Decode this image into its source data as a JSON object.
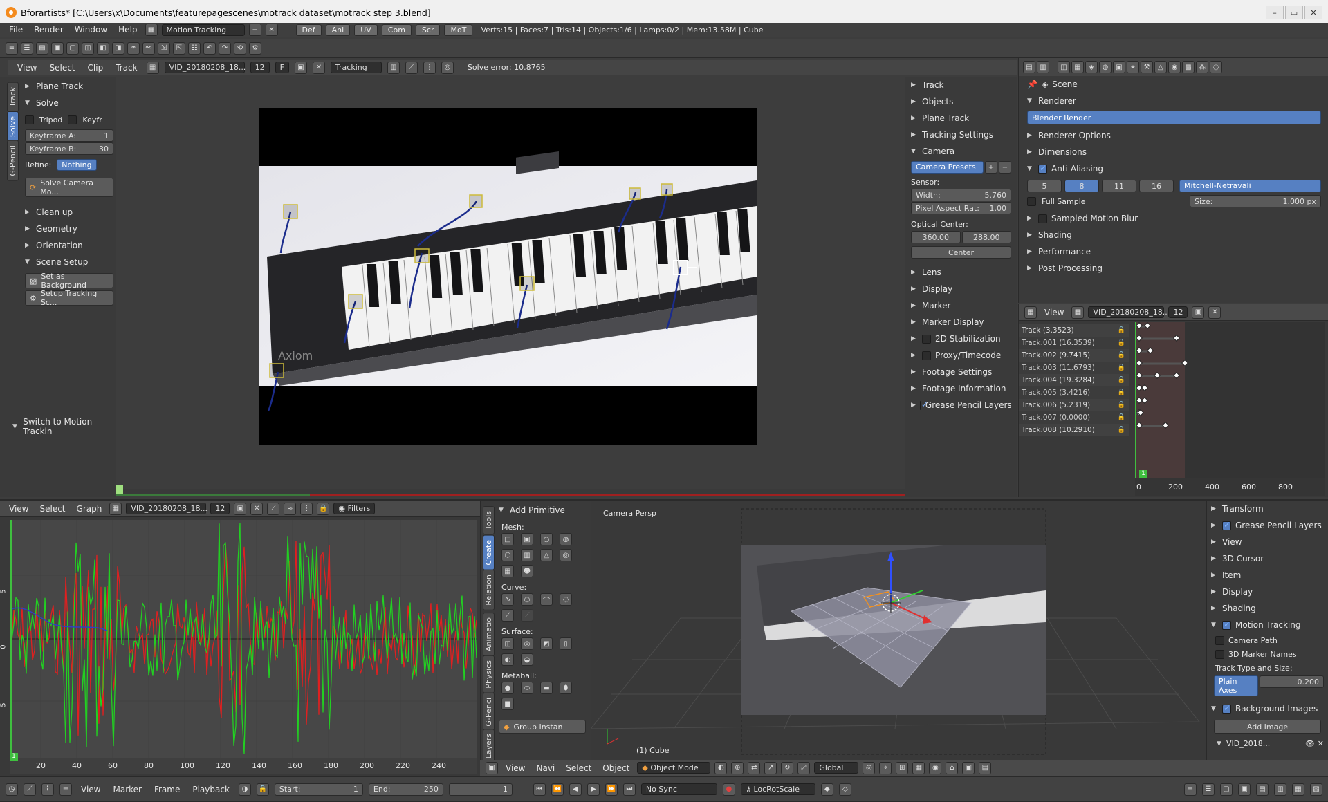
{
  "window": {
    "title": "Bforartists* [C:\\Users\\x\\Documents\\featurepagescenes\\motrack dataset\\motrack step 3.blend]"
  },
  "topbar": {
    "menus": [
      "File",
      "Render",
      "Window",
      "Help"
    ],
    "workspace": "Motion Tracking",
    "tabs": [
      "Def",
      "Ani",
      "UV",
      "Com",
      "Scr",
      "MoT"
    ],
    "stats": "Verts:15 | Faces:7 | Tris:14 | Objects:1/6 | Lamps:0/2 | Mem:13.58M | Cube"
  },
  "clip_header": {
    "menus": [
      "View",
      "Select",
      "Clip",
      "Track"
    ],
    "clip_name": "VID_20180208_18...",
    "clip_users": "12",
    "fake": "F",
    "mode": "Tracking",
    "solve_error": "Solve error: 10.8765"
  },
  "toolshelf": {
    "tabs": [
      "Track",
      "Solve",
      "G-Pencil"
    ],
    "plane_track": "Plane Track",
    "solve": "Solve",
    "tripod": "Tripod",
    "keyframe": "Keyfr",
    "keyframe_a_label": "Keyframe A:",
    "keyframe_a_val": "1",
    "keyframe_b_label": "Keyframe B:",
    "keyframe_b_val": "30",
    "refine_label": "Refine:",
    "refine_val": "Nothing",
    "solve_btn": "Solve Camera Mo...",
    "cleanup": "Clean up",
    "geometry": "Geometry",
    "orientation": "Orientation",
    "scene_setup": "Scene Setup",
    "set_bg": "Set as Background",
    "setup_scene": "Setup Tracking Sc...",
    "switch": "Switch to Motion Trackin"
  },
  "clip_props": {
    "items_top": [
      "Track",
      "Objects",
      "Plane Track",
      "Tracking Settings"
    ],
    "camera": "Camera",
    "camera_presets": "Camera Presets",
    "sensor": "Sensor:",
    "width_label": "Width:",
    "width_val": "5.760",
    "par_label": "Pixel Aspect Rat:",
    "par_val": "1.00",
    "optical": "Optical Center:",
    "oc_x": "360.00",
    "oc_y": "288.00",
    "center": "Center",
    "items_bottom": [
      "Lens",
      "Display",
      "Marker",
      "Marker Display"
    ],
    "stab": "2D Stabilization",
    "proxy": "Proxy/Timecode",
    "footage_settings": "Footage Settings",
    "footage_info": "Footage Information",
    "gp_layers": "Grease Pencil Layers"
  },
  "render_props": {
    "scene": "Scene",
    "renderer": "Renderer",
    "engine": "Blender Render",
    "items": [
      "Renderer Options",
      "Dimensions"
    ],
    "aa": "Anti-Aliasing",
    "aa_samples": [
      "5",
      "8",
      "11",
      "16"
    ],
    "filter": "Mitchell-Netravali",
    "full_sample": "Full Sample",
    "size_label": "Size:",
    "size_val": "1.000 px",
    "smb": "Sampled Motion Blur",
    "more": [
      "Shading",
      "Performance",
      "Post Processing"
    ]
  },
  "dopesheet": {
    "view": "View",
    "clip_name": "VID_20180208_18...",
    "clip_users": "12",
    "tracks": [
      "Track (3.3523)",
      "Track.001 (16.3539)",
      "Track.002 (9.7415)",
      "Track.003 (11.6793)",
      "Track.004 (19.3284)",
      "Track.005 (3.4216)",
      "Track.006 (5.2319)",
      "Track.007 (0.0000)",
      "Track.008 (10.2910)"
    ],
    "axis": [
      "0",
      "200",
      "400",
      "600",
      "800"
    ],
    "current_frame": "1"
  },
  "graph": {
    "menus": [
      "View",
      "Select",
      "Graph"
    ],
    "clip_name": "VID_20180208_18...",
    "clip_users": "12",
    "filters": "Filters",
    "x_ticks": [
      "20",
      "40",
      "60",
      "80",
      "100",
      "120",
      "140",
      "160",
      "180",
      "200",
      "220",
      "240"
    ],
    "y_ticks": [
      "5",
      "0",
      "5"
    ],
    "current_frame": "1"
  },
  "create_panel": {
    "tabs": [
      "Tools",
      "Create",
      "Relation",
      "Animatio",
      "Physics",
      "G-Penci",
      "Layers"
    ],
    "title": "Add Primitive",
    "mesh": "Mesh:",
    "curve": "Curve:",
    "surface": "Surface:",
    "metaball": "Metaball:",
    "group": "Group Instan"
  },
  "viewport": {
    "label": "Camera Persp",
    "object": "(1) Cube",
    "menus": [
      "View",
      "Navi",
      "Select",
      "Object"
    ],
    "mode": "Object Mode",
    "orientation": "Global"
  },
  "view_props": {
    "items": [
      "Transform"
    ],
    "gp_layers": "Grease Pencil Layers",
    "items2": [
      "View",
      "3D Cursor",
      "Item",
      "Display",
      "Shading"
    ],
    "motion_tracking": "Motion Tracking",
    "camera_path": "Camera Path",
    "marker_names": "3D Marker Names",
    "track_type_label": "Track Type and Size:",
    "track_type": "Plain Axes",
    "track_size": "0.200",
    "bg_images": "Background Images",
    "add_image": "Add Image",
    "bg_clip": "VID_2018..."
  },
  "timeline": {
    "menus": [
      "View",
      "Marker",
      "Frame",
      "Playback"
    ],
    "start_label": "Start:",
    "start": "1",
    "end_label": "End:",
    "end": "250",
    "frame": "1",
    "sync": "No Sync",
    "keying": "LocRotScale"
  },
  "colors": {
    "accent": "#5680c2",
    "track_path": "#1b2c8c",
    "graph_red": "#e02020",
    "graph_green": "#22d022"
  }
}
